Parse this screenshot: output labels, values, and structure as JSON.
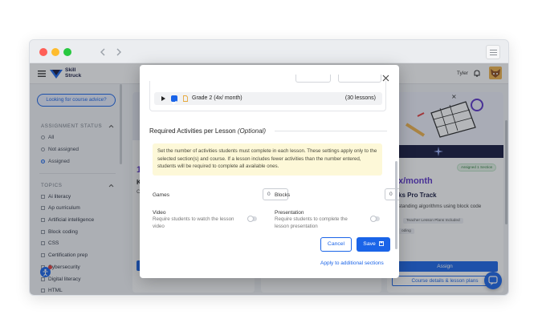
{
  "window": {
    "back_icon": "chevron-left-icon",
    "forward_icon": "chevron-right-icon",
    "menu_icon": "hamburger-icon"
  },
  "appbar": {
    "logo_line1": "Skill",
    "logo_line2": "Struck",
    "user_name": "Tyler"
  },
  "sidebar": {
    "advice_button": "Looking for course advice?",
    "status_label": "ASSIGNMENT STATUS",
    "status_options": [
      "All",
      "Not assigned",
      "Assigned"
    ],
    "topics_label": "TOPICS",
    "topics": [
      "Ai literacy",
      "Ap curriculum",
      "Artificial intelligence",
      "Block coding",
      "CSS",
      "Certification prep",
      "Cybersecurity",
      "Digital literacy",
      "HTML"
    ]
  },
  "cards": {
    "badge": "Assigned 1 Section",
    "course_title": "x/month",
    "course_name": "ks Pro Track",
    "course_desc": "standing algorithms using block code",
    "tag1": "Teacher Lesson Plans Included",
    "tag2": "oding",
    "assign_button": "Assign",
    "details_link": "Course details & lesson plans",
    "left_partial_1": "1",
    "left_partial_2": "K",
    "left_partial_3": "C"
  },
  "modal": {
    "grade_row_label": "Grade 2 (4x/ month)",
    "grade_row_count": "(30 lessons)",
    "section_title": "Required Activities per Lesson",
    "section_optional": "(Optional)",
    "info_text": "Set the number of activities students must complete in each lesson. These settings apply only to the selected section(s) and course. If a lesson includes fewer activities than the number entered, students will be required to complete all available ones.",
    "games_label": "Games",
    "games_value": "0",
    "blocks_label": "Blocks",
    "blocks_value": "0",
    "video_label": "Video",
    "video_desc": "Require students to watch the lesson video",
    "presentation_label": "Presentation",
    "presentation_desc": "Require students to complete the lesson presentation",
    "cancel_label": "Cancel",
    "save_label": "Save",
    "apply_link": "Apply to additional sections"
  },
  "colors": {
    "primary": "#1a64e8",
    "info_bg": "#fdf8d8",
    "brand": "#13163d",
    "purple": "#5b34c9"
  }
}
